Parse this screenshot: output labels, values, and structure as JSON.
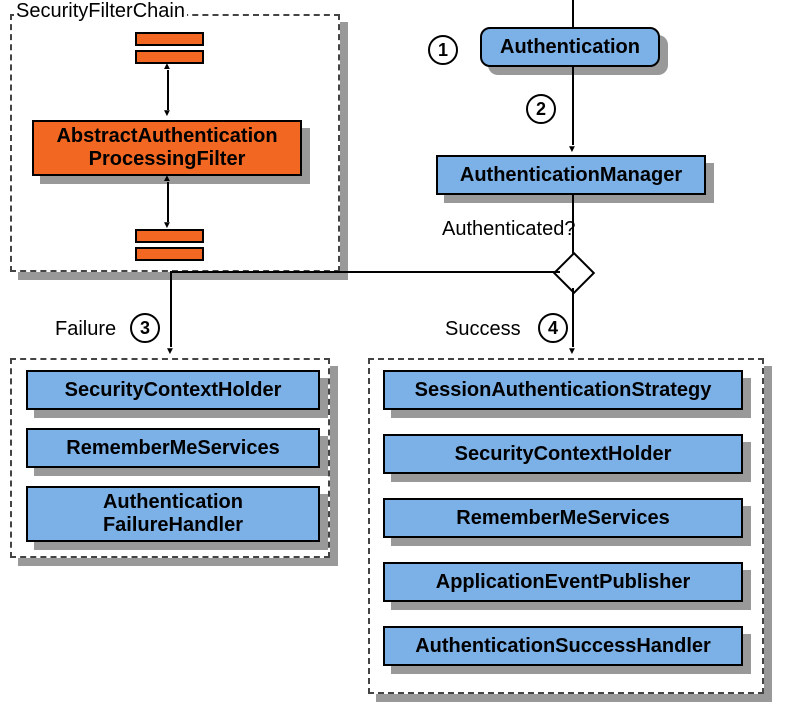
{
  "filterChain": {
    "title": "SecurityFilterChain",
    "center": "AbstractAuthentication\nProcessingFilter"
  },
  "step1": "Authentication",
  "step2": "AuthenticationManager",
  "decision": "Authenticated?",
  "failure": {
    "title": "Failure",
    "items": [
      "SecurityContextHolder",
      "RememberMeServices",
      "Authentication\nFailureHandler"
    ]
  },
  "success": {
    "title": "Success",
    "items": [
      "SessionAuthenticationStrategy",
      "SecurityContextHolder",
      "RememberMeServices",
      "ApplicationEventPublisher",
      "AuthenticationSuccessHandler"
    ]
  },
  "nums": {
    "n1": "1",
    "n2": "2",
    "n3": "3",
    "n4": "4"
  }
}
